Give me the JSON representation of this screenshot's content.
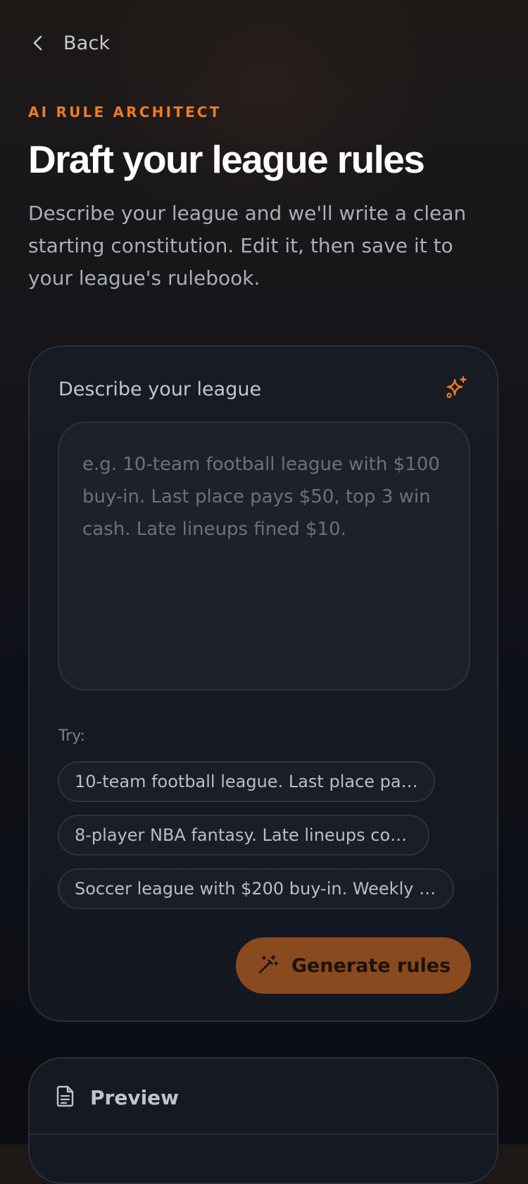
{
  "nav": {
    "back_label": "Back",
    "back_icon": "chevron-left-icon"
  },
  "header": {
    "eyebrow": "AI RULE ARCHITECT",
    "title": "Draft your league rules",
    "subtitle": "Describe your league and we'll write a clean starting constitution. Edit it, then save it to your league's rulebook."
  },
  "describe_card": {
    "title": "Describe your league",
    "icon": "sparkles-icon",
    "input": {
      "value": "",
      "placeholder": "e.g. 10-team football league with $100 buy-in. Last place pays $50, top 3 win cash. Late lineups fined $10."
    },
    "try_label": "Try:",
    "suggestions": [
      "10-team football league. Last place pays...",
      "8-player NBA fantasy. Late lineups cost ...",
      "Soccer league with $200 buy-in. Weekly w..."
    ],
    "generate_button": {
      "label": "Generate rules",
      "icon": "magic-wand-icon"
    }
  },
  "preview_card": {
    "title": "Preview",
    "icon": "document-icon"
  },
  "colors": {
    "accent": "#ef7a26",
    "button_bg": "#8a4a1f",
    "card_bg": "#171b24",
    "page_bg": "#0e1017"
  }
}
